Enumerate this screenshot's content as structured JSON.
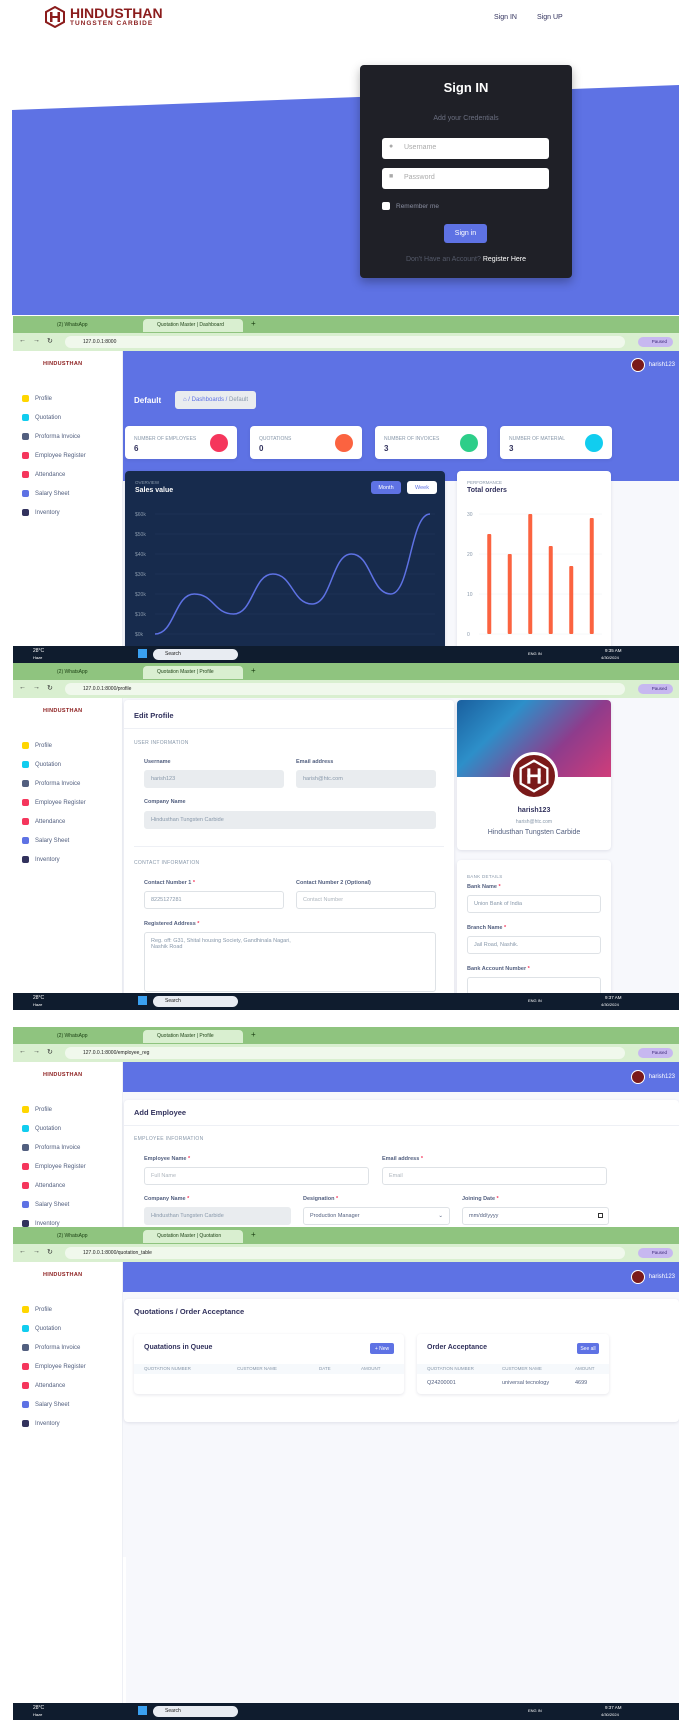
{
  "login": {
    "brand_name": "HINDUSTHAN",
    "brand_sub": "TUNGSTEN CARBIDE",
    "nav_signin": "Sign IN",
    "nav_signup": "Sign UP",
    "card_title": "Sign IN",
    "card_subtitle": "Add your Credentials",
    "username_placeholder": "Username",
    "password_placeholder": "Password",
    "remember": "Remember me",
    "submit": "Sign in",
    "no_account": "Don't Have an Account?",
    "register": "Register Here"
  },
  "browser": {
    "tab_whatsapp": "(2) WhatsApp",
    "tab_dashboard": "Quotation Master | Dashboard",
    "tab_profile": "Quotation Master | Profile",
    "tab_quotation": "Quotation Master | Quotation",
    "url_dashboard": "127.0.0.1:8000",
    "url_profile": "127.0.0.1:8000/profile",
    "url_employee": "127.0.0.1:8000/employee_reg",
    "url_quotation": "127.0.0.1:8000/quotation_table",
    "profile_chip": "Paused",
    "new_tab": "+"
  },
  "sidebar": {
    "logo": "HINDUSTHAN",
    "items": [
      {
        "label": "Profile",
        "color": "#ffd600"
      },
      {
        "label": "Quotation",
        "color": "#11cdef"
      },
      {
        "label": "Proforma Invoice",
        "color": "#525f7f"
      },
      {
        "label": "Employee Register",
        "color": "#f5365c"
      },
      {
        "label": "Attendance",
        "color": "#f5365c"
      },
      {
        "label": "Salary Sheet",
        "color": "#5e72e4"
      },
      {
        "label": "Inventory",
        "color": "#32325d"
      }
    ]
  },
  "user": "harish123",
  "dashboard": {
    "title": "Default",
    "breadcrumb_1": "Dashboards",
    "breadcrumb_2": "Default",
    "stats": [
      {
        "label": "NUMBER OF EMPLOYEES",
        "value": "6",
        "color": "#f5365c"
      },
      {
        "label": "QUOTATIONS",
        "value": "0",
        "color": "#fb6340"
      },
      {
        "label": "NUMBER OF INVOICES",
        "value": "3",
        "color": "#2dce89"
      },
      {
        "label": "NUMBER OF MATERIAL",
        "value": "3",
        "color": "#11cdef"
      }
    ],
    "overview": "OVERVIEW",
    "sales_title": "Sales value",
    "btn_month": "Month",
    "btn_week": "Week",
    "performance": "PERFORMANCE",
    "orders_title": "Total orders"
  },
  "chart_data": [
    {
      "type": "line",
      "title": "Sales value",
      "yticks": [
        "$60k",
        "$50k",
        "$40k",
        "$30k",
        "$20k",
        "$10k",
        "$0k"
      ],
      "ylim": [
        0,
        60
      ],
      "values": [
        0,
        20,
        10,
        30,
        15,
        40,
        20,
        60
      ],
      "grid": true
    },
    {
      "type": "bar",
      "title": "Total orders",
      "yticks": [
        "30",
        "20",
        "10",
        "0"
      ],
      "ylim": [
        0,
        30
      ],
      "values": [
        25,
        20,
        30,
        22,
        17,
        29
      ],
      "color": "#fb6340",
      "grid": true
    }
  ],
  "profile": {
    "title": "Edit Profile",
    "sec_user": "USER INFORMATION",
    "username_label": "Username",
    "username_value": "harish123",
    "email_label": "Email address",
    "email_value": "harish@htc.com",
    "company_label": "Company Name",
    "company_value": "Hindusthan Tungsten Carbide",
    "sec_contact": "CONTACT INFORMATION",
    "contact1_label": "Contact Number 1",
    "contact1_value": "8225127281",
    "contact2_label": "Contact Number 2 (Optional)",
    "contact2_placeholder": "Contact Number",
    "address_label": "Registered Address",
    "address_value": "Reg. off: G31, Shital housing Society, Gandhinala Nagari,",
    "address_value2": "Nashik Road",
    "card_name": "harish123",
    "card_email": "harish@htc.com",
    "card_company": "Hindusthan Tungsten Carbide",
    "sec_bank": "BANK DETAILS",
    "bank_label": "Bank Name",
    "bank_value": "Union Bank of India",
    "branch_label": "Branch Name",
    "branch_value": "Jail Road, Nashik.",
    "account_label": "Bank Account Number"
  },
  "employee": {
    "title": "Add Employee",
    "sec": "EMPLOYEE INFORMATION",
    "name_label": "Employee Name",
    "name_placeholder": "Full Name",
    "email_label": "Email address",
    "email_placeholder": "Email",
    "company_label": "Company Name",
    "company_value": "Hindusthan Tungsten Carbide",
    "designation_label": "Designation",
    "designation_value": "Production Manager",
    "joining_label": "Joining Date",
    "joining_placeholder": "mm/dd/yyyy"
  },
  "quotation": {
    "title": "Quotations / Order Acceptance",
    "queue_title": "Quatations in Queue",
    "new_btn": "+ New",
    "queue_cols": [
      "QUOTATION NUMBER",
      "CUSTOMER NAME",
      "DATE",
      "AMOUNT"
    ],
    "accept_title": "Order Acceptance",
    "see_all": "See all",
    "accept_cols": [
      "QUOTATION NUMBER",
      "CUSTOMER NAME",
      "AMOUNT"
    ],
    "accept_row": [
      "Q24200001",
      "universal tecnology",
      "4699"
    ]
  },
  "taskbar": {
    "weather": "28°C",
    "weather_sub": "Haze",
    "search": "Search",
    "lang": "ENG IN",
    "time1": "9:35 AM",
    "time2": "9:37 AM",
    "date": "4/30/2024"
  }
}
